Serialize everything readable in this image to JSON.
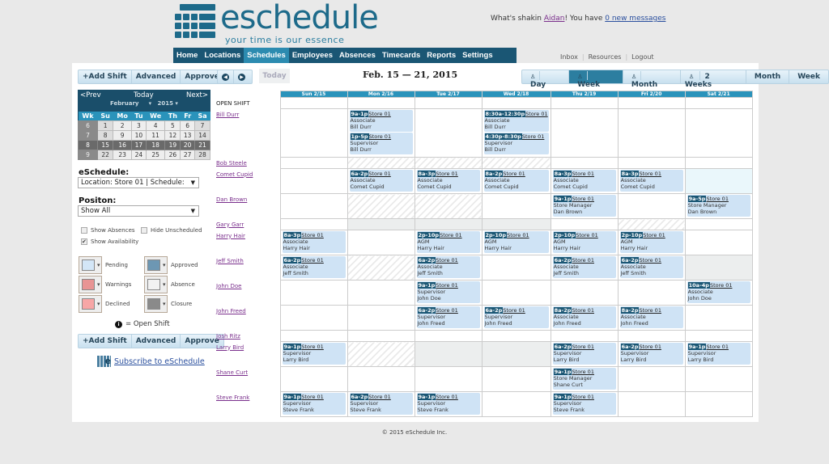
{
  "logo": {
    "word": "eschedule",
    "tagline": "your time is our essence"
  },
  "greeting": {
    "prefix": "What's shakin ",
    "user": "Aidan",
    "mid": "! You have ",
    "messages": "0 new messages"
  },
  "nav": [
    "Home",
    "Locations",
    "Schedules",
    "Employees",
    "Absences",
    "Timecards",
    "Reports",
    "Settings"
  ],
  "nav_active": "Schedules",
  "top_links": [
    "Inbox",
    "Resources",
    "Logout"
  ],
  "toolbar": {
    "add": "+Add Shift",
    "advanced": "Advanced",
    "approve": "Approve",
    "today": "Today",
    "date_range": "Feb. 15 — 21, 2015"
  },
  "views": [
    {
      "label": "Day",
      "icon": true
    },
    {
      "label": "Week",
      "icon": true,
      "active": true
    },
    {
      "label": "Month",
      "icon": true
    },
    {
      "label": "2 Weeks",
      "icon": true
    },
    {
      "label": "Month"
    },
    {
      "label": "Week"
    }
  ],
  "calendar": {
    "prev": "<Prev",
    "today": "Today",
    "next": "Next>",
    "month": "February",
    "year": "2015",
    "headers": [
      "Wk",
      "Su",
      "Mo",
      "Tu",
      "We",
      "Th",
      "Fr",
      "Sa"
    ],
    "weeks": [
      [
        "6",
        "1",
        "2",
        "3",
        "4",
        "5",
        "6",
        "7"
      ],
      [
        "7",
        "8",
        "9",
        "10",
        "11",
        "12",
        "13",
        "14"
      ],
      [
        "8",
        "15",
        "16",
        "17",
        "18",
        "19",
        "20",
        "21"
      ],
      [
        "9",
        "22",
        "23",
        "24",
        "25",
        "26",
        "27",
        "28"
      ]
    ],
    "current_week": "8"
  },
  "filters": {
    "eschedule_label": "eSchedule:",
    "eschedule_value": "Location: Store 01 | Schedule:",
    "position_label": "Positon:",
    "position_value": "Show All",
    "show_absences": {
      "label": "Show Absences",
      "checked": false
    },
    "hide_unscheduled": {
      "label": "Hide Unscheduled",
      "checked": false
    },
    "show_availability": {
      "label": "Show Availability",
      "checked": true
    }
  },
  "legend": [
    {
      "label": "Pending",
      "color": "#d3e6f7"
    },
    {
      "label": "Approved",
      "color": "#6d97b3"
    },
    {
      "label": "Warnings",
      "color": "#e89494"
    },
    {
      "label": "Absence",
      "color": "#f2f2f2"
    },
    {
      "label": "Declined",
      "color": "#f7a6a6"
    },
    {
      "label": "Closure",
      "color": "#8a8a8a"
    }
  ],
  "open_shift_legend": "= Open Shift",
  "subscribe": "Subscribe to eSchedule",
  "days": [
    "Sun 2/15",
    "Mon 2/16",
    "Tue 2/17",
    "Wed 2/18",
    "Thu 2/19",
    "Fri 2/20",
    "Sat 2/21"
  ],
  "open_shift_label": "OPEN SHIFT",
  "rows": [
    {
      "name": "Bill Durr",
      "h": 60,
      "cells": [
        null,
        [
          [
            "9a-1p",
            "Store 01",
            "Associate"
          ],
          [
            "1p-5p",
            "Store 01",
            "Supervisor"
          ]
        ],
        null,
        [
          [
            "8:30a-12:30p",
            "Store 01",
            "Associate"
          ],
          [
            "4:30p-8:30p",
            "Store 01",
            "Supervisor"
          ]
        ],
        null,
        null,
        null
      ]
    },
    {
      "name": "Bob Steele",
      "h": 14,
      "cells": [
        null,
        "hatch",
        "hatch",
        "hatch",
        null,
        null,
        null
      ]
    },
    {
      "name": "Comet Cupid",
      "h": 31,
      "cells": [
        null,
        [
          [
            "6a-2p",
            "Store 01",
            "Associate"
          ]
        ],
        [
          [
            "8a-3p",
            "Store 01",
            "Associate"
          ]
        ],
        [
          [
            "8a-2p",
            "Store 01",
            "Associate"
          ]
        ],
        [
          [
            "8a-3p",
            "Store 01",
            "Associate"
          ]
        ],
        [
          [
            "8a-3p",
            "Store 01",
            "Associate"
          ]
        ],
        "lb"
      ]
    },
    {
      "name": "Dan Brown",
      "h": 31,
      "cells": [
        null,
        "hatch",
        "hatch",
        null,
        [
          [
            "9a-1p",
            "Store 01",
            "Store Manager"
          ]
        ],
        null,
        [
          [
            "9a-5p",
            "Store 01",
            "Store Manager"
          ]
        ]
      ]
    },
    {
      "name": "Gary Garr",
      "h": 14,
      "cells": [
        null,
        "gray",
        "gray",
        "gray",
        null,
        "hatch",
        null
      ]
    },
    {
      "name": "Harry Hair",
      "h": 31,
      "cells": [
        [
          [
            "8a-3p",
            "Store 01",
            "Associate"
          ]
        ],
        null,
        [
          [
            "2p-10p",
            "Store 01",
            "AGM"
          ]
        ],
        [
          [
            "2p-10p",
            "Store 01",
            "AGM"
          ]
        ],
        [
          [
            "2p-10p",
            "Store 01",
            "AGM"
          ]
        ],
        [
          [
            "2p-10p",
            "Store 01",
            "AGM"
          ]
        ],
        null
      ]
    },
    {
      "name": "Jeff Smith",
      "h": 31,
      "cells": [
        [
          [
            "6a-2p",
            "Store 01",
            "Associate"
          ]
        ],
        "hatch",
        [
          [
            "6a-2p",
            "Store 01",
            "Associate"
          ]
        ],
        null,
        [
          [
            "6a-2p",
            "Store 01",
            "Associate"
          ]
        ],
        [
          [
            "6a-2p",
            "Store 01",
            "Associate"
          ]
        ],
        "gray"
      ]
    },
    {
      "name": "John Doe",
      "h": 31,
      "cells": [
        null,
        null,
        [
          [
            "9a-1p",
            "Store 01",
            "Supervisor"
          ]
        ],
        null,
        null,
        null,
        [
          [
            "10a-4p",
            "Store 01",
            "Associate"
          ]
        ]
      ]
    },
    {
      "name": "John Freed",
      "h": 31,
      "cells": [
        null,
        null,
        [
          [
            "6a-2p",
            "Store 01",
            "Supervisor"
          ]
        ],
        [
          [
            "6a-2p",
            "Store 01",
            "Supervisor"
          ]
        ],
        [
          [
            "8a-2p",
            "Store 01",
            "Associate"
          ]
        ],
        [
          [
            "8a-2p",
            "Store 01",
            "Associate"
          ]
        ],
        null
      ]
    },
    {
      "name": "Josh Ritz",
      "h": 14,
      "cells": [
        null,
        null,
        null,
        null,
        null,
        null,
        null
      ]
    },
    {
      "name": "Larry Bird",
      "h": 31,
      "cells": [
        [
          [
            "9a-1p",
            "Store 01",
            "Supervisor"
          ]
        ],
        "hatch",
        "gray",
        "gray",
        [
          [
            "6a-2p",
            "Store 01",
            "Supervisor"
          ]
        ],
        [
          [
            "6a-2p",
            "Store 01",
            "Supervisor"
          ]
        ],
        [
          [
            "9a-1p",
            "Store 01",
            "Supervisor"
          ]
        ]
      ]
    },
    {
      "name": "Shane Curt",
      "h": 31,
      "cells": [
        null,
        null,
        null,
        null,
        [
          [
            "9a-1p",
            "Store 01",
            "Store Manager"
          ]
        ],
        null,
        null
      ]
    },
    {
      "name": "Steve Frank",
      "h": 31,
      "cells": [
        [
          [
            "9a-1p",
            "Store 01",
            "Supervisor"
          ]
        ],
        [
          [
            "6a-2p",
            "Store 01",
            "Supervisor"
          ]
        ],
        [
          [
            "9a-1p",
            "Store 01",
            "Supervisor"
          ]
        ],
        null,
        [
          [
            "9a-1p",
            "Store 01",
            "Supervisor"
          ]
        ],
        null,
        null
      ]
    }
  ],
  "footer": "© 2015 eSchedule Inc."
}
